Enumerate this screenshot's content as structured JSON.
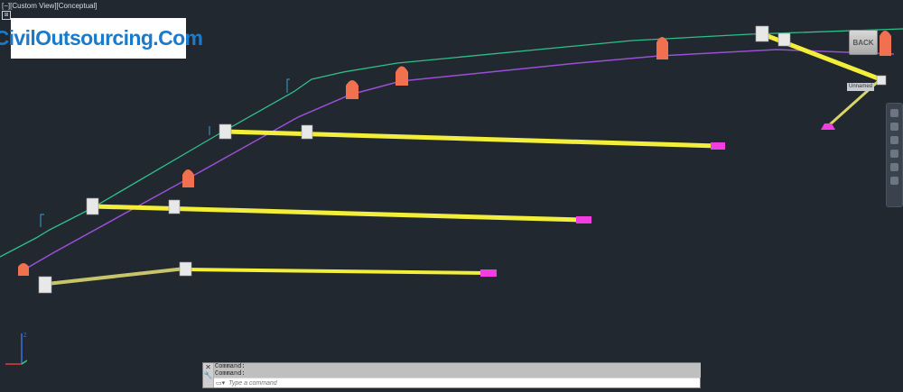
{
  "viewport": {
    "label": "[−][Custom View][Conceptual]"
  },
  "watermark": {
    "text": "CivilOutsourcing.Com"
  },
  "viewcube": {
    "back_label": "BACK"
  },
  "tags": {
    "unnamed": "Unnamed"
  },
  "command_line": {
    "history": [
      "Command:",
      "Command:"
    ],
    "placeholder": "Type a command",
    "close_glyph": "✕",
    "settings_glyph": "🔧"
  },
  "colors": {
    "background": "#212830",
    "alignment": "#2fbf8a",
    "profile": "#9b4fd6",
    "pipe": "#f2ee3a",
    "structure": "#f07050",
    "endwall": "#f23ee0"
  },
  "icons": [
    "ucs-axis-icon",
    "viewport-control-icon",
    "navigation-bar",
    "viewcube"
  ]
}
